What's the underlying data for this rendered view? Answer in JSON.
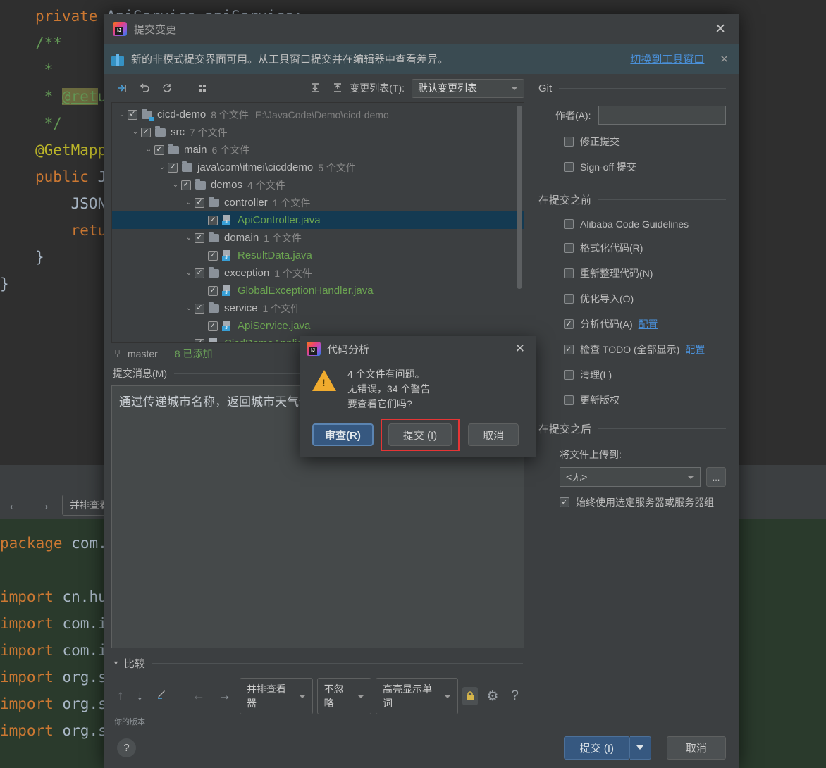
{
  "background_editor": {
    "top_code_lines": [
      "    private ApiService apiService;",
      "    /**",
      "     *",
      "     * @return",
      "     */",
      "    @GetMapping(\"/weather\")",
      "    public JSONObject weather(String city) {",
      "        JSONObject result = apiService.getWeather(city);",
      "        return result;",
      "    }",
      "}"
    ],
    "bottom_code_lines": [
      "package com.itmei.cicddemo.demos.controller;",
      "",
      "import cn.hutool.json.JSONObject;",
      "import com.itmei.cicddemo.demos.domain.ResultData;",
      "import com.itmei.cicddemo.demos.service.ApiService;",
      "import org.springframework.beans.factory.annotation.Autowired;",
      "import org.springframework.web.bind.annotation.GetMapping;",
      "import org.springframework.web.bind.annotation.RestController;"
    ],
    "diff_toolbar": {
      "prev_label": "←",
      "next_label": "→",
      "viewer_label": "并排查看器"
    }
  },
  "window": {
    "title": "提交变更",
    "close_label": "✕",
    "logo_text": "IJ"
  },
  "notice": {
    "text": "新的非模式提交界面可用。从工具窗口提交并在编辑器中查看差异。",
    "link": "切换到工具窗口",
    "close": "✕"
  },
  "toolbar": {
    "icons": [
      "collapse-to-selection",
      "revert",
      "refresh",
      "group-by"
    ],
    "expand_all_label": "⇟",
    "collapse_all_label": "⇞",
    "changelist_label": "变更列表(T):",
    "changelist_value": "默认变更列表"
  },
  "tree": {
    "rows": [
      {
        "indent": 0,
        "arrow": "⌄",
        "kind": "folder",
        "name": "cicd-demo",
        "count": "8 个文件",
        "path": "E:\\JavaCode\\Demo\\cicd-demo",
        "selected": false,
        "modified": true
      },
      {
        "indent": 1,
        "arrow": "⌄",
        "kind": "folder",
        "name": "src",
        "count": "7 个文件",
        "path": "",
        "selected": false,
        "modified": false
      },
      {
        "indent": 2,
        "arrow": "⌄",
        "kind": "folder",
        "name": "main",
        "count": "6 个文件",
        "path": "",
        "selected": false,
        "modified": false
      },
      {
        "indent": 3,
        "arrow": "⌄",
        "kind": "folder",
        "name": "java\\com\\itmei\\cicddemo",
        "count": "5 个文件",
        "path": "",
        "selected": false,
        "modified": false
      },
      {
        "indent": 4,
        "arrow": "⌄",
        "kind": "folder",
        "name": "demos",
        "count": "4 个文件",
        "path": "",
        "selected": false,
        "modified": false
      },
      {
        "indent": 5,
        "arrow": "⌄",
        "kind": "folder",
        "name": "controller",
        "count": "1 个文件",
        "path": "",
        "selected": false,
        "modified": false
      },
      {
        "indent": 6,
        "arrow": "",
        "kind": "java",
        "name": "ApiController.java",
        "count": "",
        "path": "",
        "selected": true,
        "modified": false
      },
      {
        "indent": 5,
        "arrow": "⌄",
        "kind": "folder",
        "name": "domain",
        "count": "1 个文件",
        "path": "",
        "selected": false,
        "modified": false
      },
      {
        "indent": 6,
        "arrow": "",
        "kind": "java",
        "name": "ResultData.java",
        "count": "",
        "path": "",
        "selected": false,
        "modified": false
      },
      {
        "indent": 5,
        "arrow": "⌄",
        "kind": "folder",
        "name": "exception",
        "count": "1 个文件",
        "path": "",
        "selected": false,
        "modified": false
      },
      {
        "indent": 6,
        "arrow": "",
        "kind": "java",
        "name": "GlobalExceptionHandler.java",
        "count": "",
        "path": "",
        "selected": false,
        "modified": false
      },
      {
        "indent": 5,
        "arrow": "⌄",
        "kind": "folder",
        "name": "service",
        "count": "1 个文件",
        "path": "",
        "selected": false,
        "modified": false
      },
      {
        "indent": 6,
        "arrow": "",
        "kind": "java",
        "name": "ApiService.java",
        "count": "",
        "path": "",
        "selected": false,
        "modified": false
      },
      {
        "indent": 5,
        "arrow": "",
        "kind": "java",
        "name": "CicdDemoApplication.java",
        "count": "",
        "path": "",
        "selected": false,
        "modified": false
      }
    ]
  },
  "status": {
    "branch_icon": "⑂",
    "branch": "master",
    "added": "8 已添加"
  },
  "commit_message": {
    "label": "提交消息(M)",
    "value": "通过传递城市名称，返回城市天气信息"
  },
  "compare": {
    "section_label": "比较",
    "triangle": "▼",
    "icons": [
      "arrow-up",
      "arrow-down",
      "edit",
      "arrow-left",
      "arrow-right"
    ],
    "viewer_select": "并排查看器",
    "ignore_select": "不忽略",
    "highlight_select": "高亮显示单词",
    "lock_icon": "🔒",
    "settings_icon": "⚙",
    "help_icon": "?",
    "version_hint": "你的版本"
  },
  "right_panel": {
    "git": {
      "title": "Git",
      "author_label": "作者(A):",
      "author_value": "",
      "options": [
        {
          "label": "修正提交",
          "checked": false
        },
        {
          "label": "Sign-off 提交",
          "checked": false
        }
      ]
    },
    "before_commit": {
      "title": "在提交之前",
      "options": [
        {
          "label": "Alibaba Code Guidelines",
          "checked": false,
          "config": ""
        },
        {
          "label": "格式化代码(R)",
          "checked": false,
          "config": ""
        },
        {
          "label": "重新整理代码(N)",
          "checked": false,
          "config": ""
        },
        {
          "label": "优化导入(O)",
          "checked": false,
          "config": ""
        },
        {
          "label": "分析代码(A)",
          "checked": true,
          "config": "配置"
        },
        {
          "label": "检查 TODO (全部显示)",
          "checked": true,
          "config": "配置"
        },
        {
          "label": "清理(L)",
          "checked": false,
          "config": ""
        },
        {
          "label": "更新版权",
          "checked": false,
          "config": ""
        }
      ]
    },
    "after_commit": {
      "title": "在提交之后",
      "upload_label": "将文件上传到:",
      "upload_value": "<无>",
      "browse_label": "...",
      "always_use": {
        "label": "始终使用选定服务器或服务器组",
        "checked": true
      }
    }
  },
  "footer": {
    "help": "?",
    "commit_label": "提交 (I)",
    "dropdown_caret": "▼",
    "cancel_label": "取消"
  },
  "modal": {
    "title": "代码分析",
    "close": "✕",
    "warning_icon": "warning-triangle",
    "message_line1": "4 个文件有问题。",
    "message_line2": "无错误，34 个警告",
    "message_line3": "要查看它们吗?",
    "review_label": "审查(R)",
    "commit_label": "提交 (I)",
    "cancel_label": "取消",
    "highlight_color": "#e53535"
  }
}
